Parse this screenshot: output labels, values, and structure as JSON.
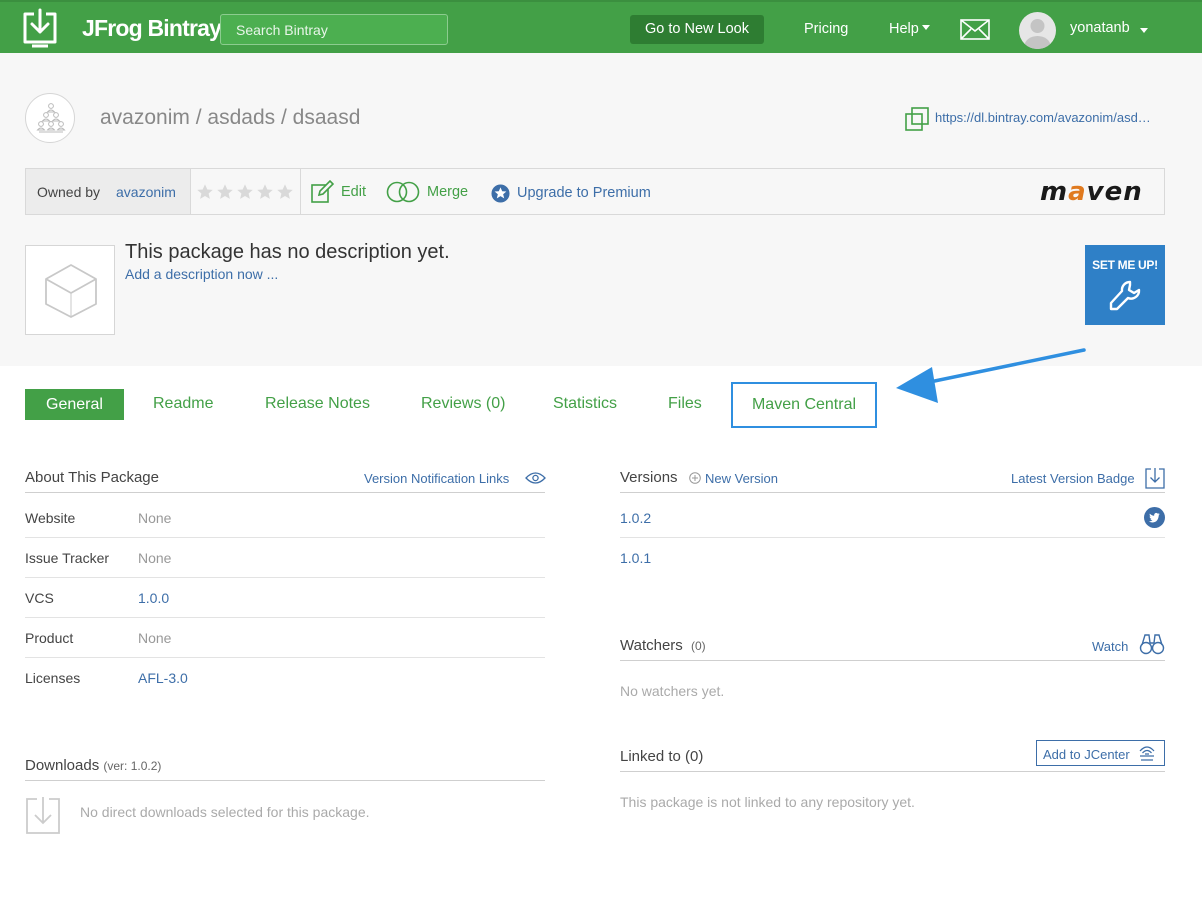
{
  "topbar": {
    "brand": "JFrog Bintray",
    "search_placeholder": "Search Bintray",
    "new_look": "Go to New Look",
    "pricing": "Pricing",
    "help": "Help",
    "username": "yonatanb"
  },
  "package": {
    "breadcrumb": [
      "avazonim",
      "asdads",
      "dsaasd"
    ],
    "download_url": "https://dl.bintray.com/avazonim/asd…",
    "owned_by_label": "Owned by",
    "owner": "avazonim",
    "rating": 0,
    "edit": "Edit",
    "merge": "Merge",
    "upgrade": "Upgrade to Premium",
    "repo_type_logo": "maven",
    "description": "This package has no description yet.",
    "add_description": "Add a description now ...",
    "set_me_up": "SET ME UP!"
  },
  "tabs": [
    {
      "label": "General"
    },
    {
      "label": "Readme"
    },
    {
      "label": "Release Notes"
    },
    {
      "label": "Reviews (0)"
    },
    {
      "label": "Statistics"
    },
    {
      "label": "Files"
    },
    {
      "label": "Maven Central"
    }
  ],
  "about": {
    "title": "About This Package",
    "notification_links": "Version Notification Links",
    "rows": [
      {
        "label": "Website",
        "value": "None"
      },
      {
        "label": "Issue Tracker",
        "value": "None"
      },
      {
        "label": "VCS",
        "value": "1.0.0"
      },
      {
        "label": "Product",
        "value": "None"
      },
      {
        "label": "Licenses",
        "value": "AFL-3.0"
      }
    ]
  },
  "downloads": {
    "title": "Downloads",
    "version_note": "(ver: 1.0.2)",
    "empty": "No direct downloads selected for this package."
  },
  "versions": {
    "title": "Versions",
    "new_version": "New Version",
    "badge": "Latest Version Badge",
    "items": [
      "1.0.2",
      "1.0.1"
    ]
  },
  "watchers": {
    "title": "Watchers",
    "count": "(0)",
    "watch": "Watch",
    "empty": "No watchers yet."
  },
  "linked": {
    "title": "Linked to (0)",
    "add_jcenter": "Add to JCenter",
    "empty": "This package is not linked to any repository yet."
  },
  "colors": {
    "brand_green": "#43a047",
    "link_blue": "#3d6ea8",
    "highlight_blue": "#2f8fe0",
    "setmeup_blue": "#2f80c7"
  }
}
